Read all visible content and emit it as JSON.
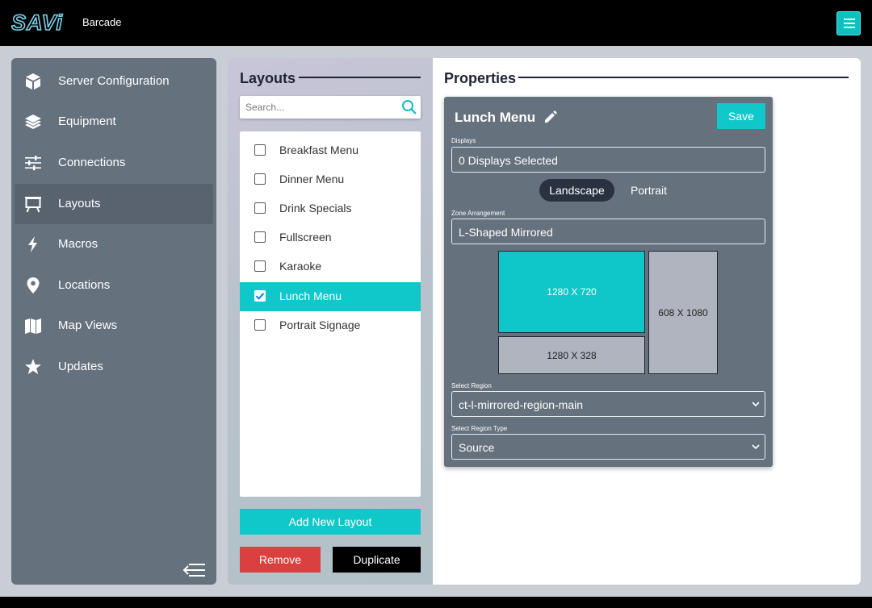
{
  "header": {
    "logo_text": "SAVi",
    "site_name": "Barcade",
    "menu_icon": "hamburger-menu-icon",
    "accent_color": "#10c7c9"
  },
  "sidebar": {
    "items": [
      {
        "label": "Server Configuration",
        "icon": "cube-icon",
        "active": false
      },
      {
        "label": "Equipment",
        "icon": "layers-icon",
        "active": false
      },
      {
        "label": "Connections",
        "icon": "sliders-icon",
        "active": false
      },
      {
        "label": "Layouts",
        "icon": "easel-icon",
        "active": true
      },
      {
        "label": "Macros",
        "icon": "bolt-icon",
        "active": false
      },
      {
        "label": "Locations",
        "icon": "map-pin-icon",
        "active": false
      },
      {
        "label": "Map Views",
        "icon": "map-icon",
        "active": false
      },
      {
        "label": "Updates",
        "icon": "star-icon",
        "active": false
      }
    ],
    "collapse_icon": "collapse-sidebar-icon"
  },
  "layouts": {
    "title": "Layouts",
    "search": {
      "placeholder": "Search...",
      "value": ""
    },
    "items": [
      {
        "label": "Breakfast Menu",
        "checked": false
      },
      {
        "label": "Dinner Menu",
        "checked": false
      },
      {
        "label": "Drink Specials",
        "checked": false
      },
      {
        "label": "Fullscreen",
        "checked": false
      },
      {
        "label": "Karaoke",
        "checked": false
      },
      {
        "label": "Lunch Menu",
        "checked": true
      },
      {
        "label": "Portrait Signage",
        "checked": false
      }
    ],
    "add_label": "Add New Layout",
    "remove_label": "Remove",
    "duplicate_label": "Duplicate"
  },
  "properties": {
    "title": "Properties",
    "layout_name": "Lunch Menu",
    "save_label": "Save",
    "displays_label": "Displays",
    "displays_value": "0 Displays Selected",
    "orientation": {
      "landscape": "Landscape",
      "portrait": "Portrait",
      "selected": "Landscape"
    },
    "zone_label": "Zone Arrangement",
    "zone_value": "L-Shaped Mirrored",
    "zones": {
      "main": "1280 X 720",
      "bottom": "1280 X 328",
      "side": "608 X 1080"
    },
    "region_label": "Select Region",
    "region_value": "ct-l-mirrored-region-main",
    "region_type_label": "Select Region Type",
    "region_type_value": "Source"
  }
}
